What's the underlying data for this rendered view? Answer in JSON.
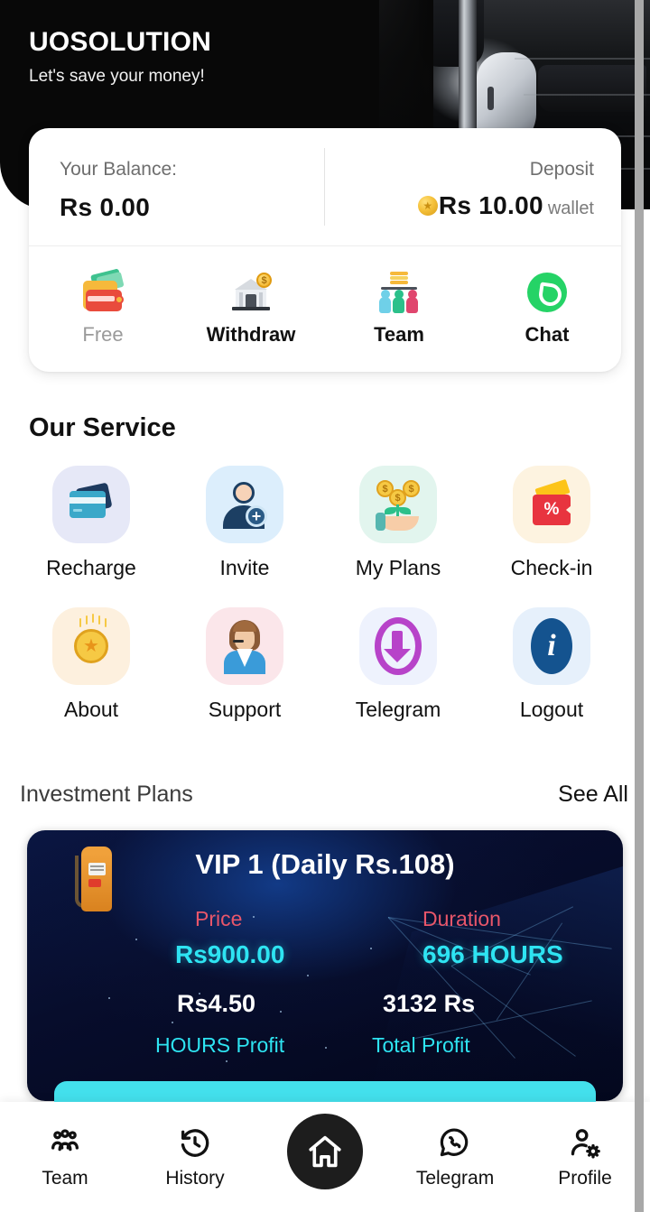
{
  "header": {
    "brand": "UOSOLUTION",
    "tagline": "Let's save your money!"
  },
  "balance": {
    "balance_label": "Your Balance:",
    "balance_value": "Rs 0.00",
    "deposit_label": "Deposit",
    "deposit_value": "Rs 10.00",
    "deposit_unit": "wallet",
    "coin_icon": "gold-coin-icon",
    "quick_actions": [
      {
        "label": "Free",
        "icon": "wallet-money-icon",
        "muted": true
      },
      {
        "label": "Withdraw",
        "icon": "bank-coin-icon",
        "muted": false
      },
      {
        "label": "Team",
        "icon": "team-hierarchy-icon",
        "muted": false
      },
      {
        "label": "Chat",
        "icon": "whatsapp-icon",
        "muted": false
      }
    ]
  },
  "service": {
    "title": "Our Service",
    "items": [
      {
        "label": "Recharge",
        "icon": "credit-cards-icon",
        "tile": "#e6e8f7"
      },
      {
        "label": "Invite",
        "icon": "add-user-icon",
        "tile": "#dceefc"
      },
      {
        "label": "My Plans",
        "icon": "money-plant-hand-icon",
        "tile": "#e2f5ee"
      },
      {
        "label": "Check-in",
        "icon": "percent-wallet-icon",
        "tile": "#fdf3e0"
      },
      {
        "label": "About",
        "icon": "medal-star-icon",
        "tile": "#fdf0de"
      },
      {
        "label": "Support",
        "icon": "headset-agent-icon",
        "tile": "#fbe6ea"
      },
      {
        "label": "Telegram",
        "icon": "download-ring-icon",
        "tile": "#eef2fd"
      },
      {
        "label": "Logout",
        "icon": "info-badge-icon",
        "tile": "#e6f0fb"
      }
    ]
  },
  "plans": {
    "title": "Investment Plans",
    "see_all": "See All",
    "card": {
      "icon": "fuel-pump-icon",
      "title": "VIP 1 (Daily Rs.108)",
      "price_label": "Price",
      "price_value": "Rs900.00",
      "duration_label": "Duration",
      "duration_value": "696 HOURS",
      "hours_profit_value": "Rs4.50",
      "hours_profit_label": "HOURS Profit",
      "total_profit_value": "3132 Rs",
      "total_profit_label": "Total Profit"
    }
  },
  "bottom_nav": {
    "items": [
      {
        "label": "Team",
        "icon": "group-people-icon"
      },
      {
        "label": "History",
        "icon": "clock-rewind-icon"
      },
      {
        "label": "",
        "icon": "home-icon"
      },
      {
        "label": "Telegram",
        "icon": "whatsapp-outline-icon"
      },
      {
        "label": "Profile",
        "icon": "person-gear-icon"
      }
    ]
  },
  "colors": {
    "accent_cyan": "#2ee4f2",
    "accent_red": "#e8566a",
    "dark_header": "#080808",
    "nav_active": "#1d1d1d"
  }
}
